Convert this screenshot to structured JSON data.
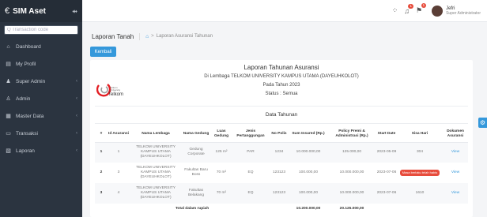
{
  "app": {
    "logo": "€",
    "name": "SIM Aset",
    "toggle": "⇹"
  },
  "search": {
    "placeholder": "Q Transaction code"
  },
  "sidebar": {
    "items": [
      {
        "label": "Dashboard",
        "icon": "⌂",
        "chevron": ""
      },
      {
        "label": "My Profil",
        "icon": "▤",
        "chevron": ""
      },
      {
        "label": "Super Admin",
        "icon": "♟",
        "chevron": "‹"
      },
      {
        "label": "Admin",
        "icon": "♙",
        "chevron": "‹"
      },
      {
        "label": "Master Data",
        "icon": "▦",
        "chevron": "‹"
      },
      {
        "label": "Transaksi",
        "icon": "▭",
        "chevron": "‹"
      },
      {
        "label": "Laporan",
        "icon": "▧",
        "chevron": "‹"
      }
    ]
  },
  "topbar": {
    "grid_icon": "⁘",
    "bell_icon": "♫",
    "bell_badge": "1",
    "flag_icon": "⚑",
    "flag_badge": "1",
    "user_name": "Jefri",
    "user_role": "Super Administrator"
  },
  "breadcrumb": {
    "title": "Laporan Tanah",
    "home": "⌂",
    "sep": ">",
    "current": "Laporan Asuransi Tahunan"
  },
  "back_button": "Kembali",
  "report": {
    "title": "Laporan Tahunan Asuransi",
    "institution": "Di Lembaga TELKOM UNIVERSITY KAMPUS UTAMA (DAYEUHKOLOT)",
    "year": "Pada Tahun 2023",
    "status": "Status : Semua",
    "section": "Data Tahunan",
    "logo_small": "Telkom\nUniversity",
    "logo_text": "Telkom"
  },
  "table": {
    "headers": [
      "#",
      "Id Asuransi",
      "Nama Lembaga",
      "Nama Gedung",
      "Luas Gedung",
      "Jenis Pertanggungan",
      "No Polis",
      "Sum Insured (Rp.)",
      "Policy Premi & Administrasi (Rp.)",
      "Start Date",
      "Sisa Hari",
      "Dokumen Asuransi"
    ],
    "rows": [
      {
        "no": "1",
        "id": "1",
        "lembaga": "TELKOM UNIVERSITY KAMPUS UTAMA (DAYEUHKOLOT)",
        "gedung": "Gedung Corporate",
        "luas": "125 m²",
        "jenis": "PAR",
        "polis": "1234",
        "sum": "10.000.000,00",
        "premi": "125.000,00",
        "start": "2023-05-09",
        "sisa": "304",
        "sisa_badge": false,
        "doc": "View"
      },
      {
        "no": "2",
        "id": "3",
        "lembaga": "TELKOM UNIVERSITY KAMPUS UTAMA (DAYEUHKOLOT)",
        "gedung": "Fakultas Baru Boss",
        "luas": "70 m²",
        "jenis": "EQ",
        "polis": "123123",
        "sum": "100.000,00",
        "premi": "10.000.000,00",
        "start": "2023-07-06",
        "sisa": "Masa berlaku telah habis",
        "sisa_badge": true,
        "doc": "View"
      },
      {
        "no": "3",
        "id": "4",
        "lembaga": "TELKOM UNIVERSITY KAMPUS UTAMA (DAYEUHKOLOT)",
        "gedung": "Fakultas Belakang",
        "luas": "70 m²",
        "jenis": "EQ",
        "polis": "123123",
        "sum": "100.000,00",
        "premi": "10.000.000,00",
        "start": "2023-07-06",
        "sisa": "1610",
        "sisa_badge": false,
        "doc": "View"
      }
    ],
    "total_label": "Total dalam rupiah",
    "total_sum": "10.200.000,00",
    "total_premi": "20.125.000,00"
  },
  "colors": {
    "primary": "#3498db",
    "sidebar": "#2b3440",
    "danger": "#e74c3c"
  },
  "gear_icon": "⚙"
}
